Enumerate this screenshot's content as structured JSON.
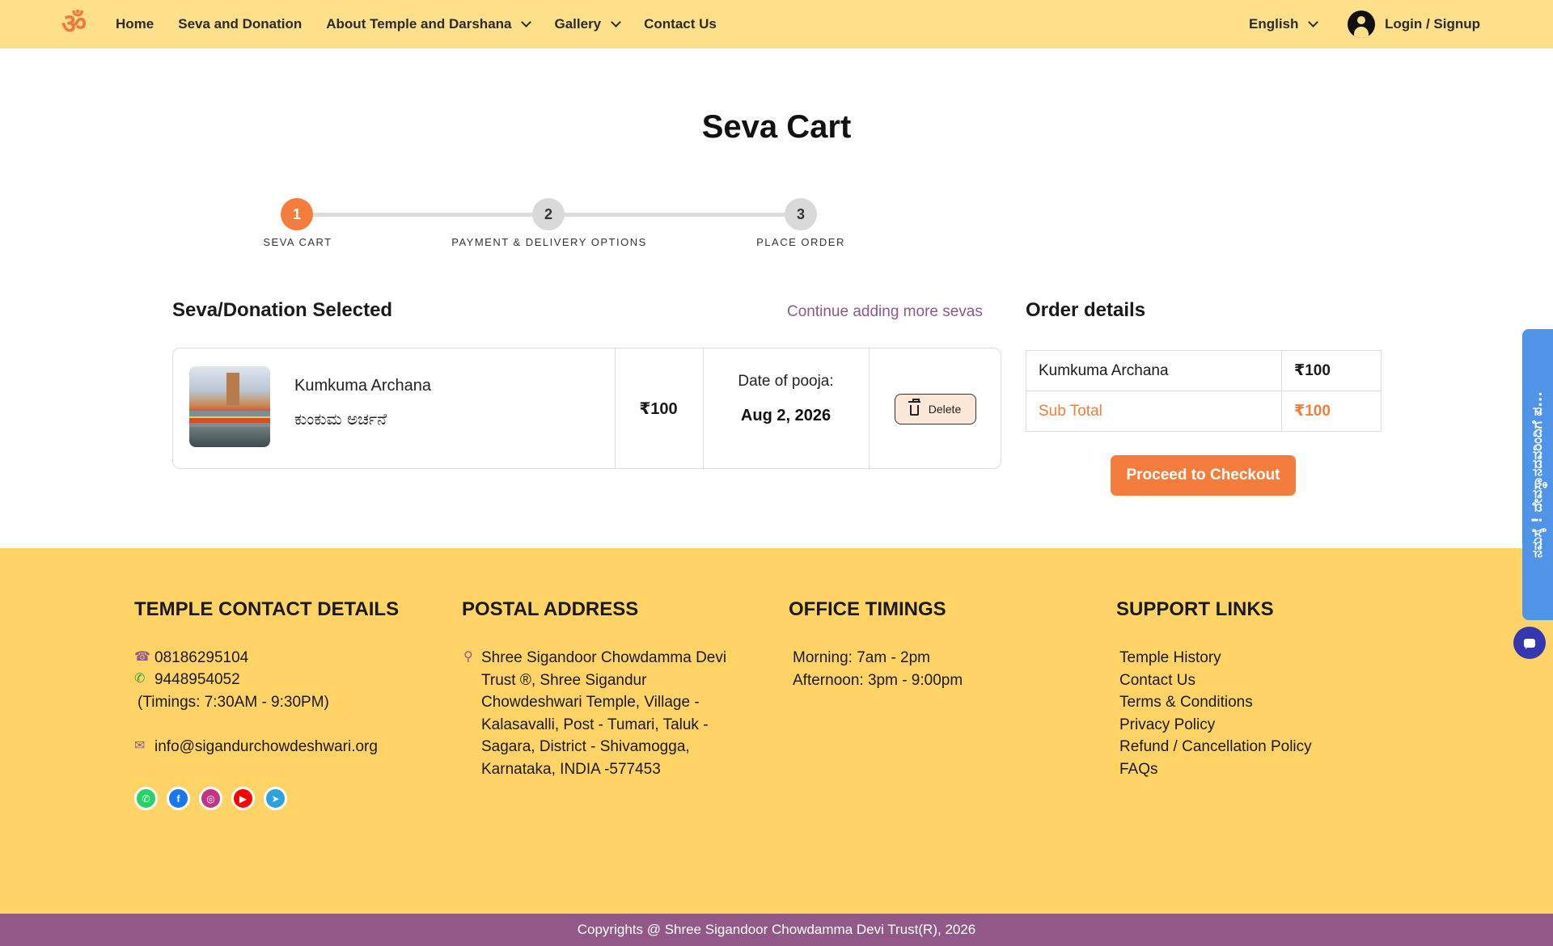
{
  "header": {
    "logo_symbol": "ॐ",
    "nav": [
      {
        "label": "Home",
        "dropdown": false
      },
      {
        "label": "Seva and Donation",
        "dropdown": false
      },
      {
        "label": "About Temple and Darshana",
        "dropdown": true
      },
      {
        "label": "Gallery",
        "dropdown": true
      },
      {
        "label": "Contact Us",
        "dropdown": false
      }
    ],
    "language": "English",
    "login_label": "Login / Signup"
  },
  "page": {
    "title": "Seva Cart"
  },
  "stepper": {
    "steps": [
      {
        "number": "1",
        "label": "SEVA CART",
        "active": true
      },
      {
        "number": "2",
        "label": "PAYMENT & DELIVERY OPTIONS",
        "active": false
      },
      {
        "number": "3",
        "label": "PLACE ORDER",
        "active": false
      }
    ]
  },
  "selection": {
    "heading": "Seva/Donation Selected",
    "continue_link": "Continue adding more sevas",
    "item": {
      "name_en": "Kumkuma Archana",
      "name_kn": "ಕುಂಕುಮ ಅರ್ಚನೆ",
      "price": "₹100",
      "date_label": "Date of pooja:",
      "date_value": "Aug 2, 2026",
      "delete_label": "Delete"
    }
  },
  "order": {
    "heading": "Order details",
    "rows": [
      {
        "name": "Kumkuma Archana",
        "amount": "₹100"
      },
      {
        "name": "Sub Total",
        "amount": "₹100"
      }
    ],
    "checkout_label": "Proceed to Checkout"
  },
  "footer": {
    "contact": {
      "heading": "TEMPLE CONTACT DETAILS",
      "phone": "08186295104",
      "whatsapp": "9448954052",
      "timings": "(Timings: 7:30AM - 9:30PM)",
      "email": "info@sigandurchowdeshwari.org"
    },
    "postal": {
      "heading": "POSTAL ADDRESS",
      "lines": [
        "Shree Sigandoor Chowdamma Devi",
        "Trust ®, Shree Sigandur",
        "Chowdeshwari Temple, Village -",
        "Kalasavalli, Post - Tumari, Taluk -",
        "Sagara, District - Shivamogga,",
        "Karnataka, INDIA -577453"
      ]
    },
    "timings": {
      "heading": "OFFICE TIMINGS",
      "morning": "Morning: 7am - 2pm",
      "afternoon": "Afternoon: 3pm - 9:00pm"
    },
    "support": {
      "heading": "SUPPORT LINKS",
      "links": [
        "Temple History",
        "Contact Us",
        "Terms & Conditions",
        "Privacy Policy",
        "Refund / Cancellation Policy",
        "FAQs"
      ]
    },
    "social": [
      {
        "name": "whatsapp-icon",
        "color": "#25d366",
        "glyph": "✆"
      },
      {
        "name": "facebook-icon",
        "color": "#1877f2",
        "glyph": "f"
      },
      {
        "name": "instagram-icon",
        "color": "#c13584",
        "glyph": "◎"
      },
      {
        "name": "youtube-icon",
        "color": "#ff0000",
        "glyph": "▶"
      },
      {
        "name": "telegram-icon",
        "color": "#2aa3de",
        "glyph": "➤"
      }
    ],
    "copyright": "Copyrights @ Shree Sigandoor Chowdamma Devi Trust(R), 2026"
  },
  "side_tab": {
    "text": "ನಮಸ್ಕೆ ! ದೇವಸ್ಥಾನದವರಿಂದಿಗೆ ಪ..."
  },
  "colors": {
    "header_bg": "#ffe08a",
    "accent": "#f47c3c",
    "footer_bg": "#ffd366",
    "copyright_bg": "#925887",
    "link_purple": "#8a5a8a",
    "side_tab": "#4f94e6"
  }
}
